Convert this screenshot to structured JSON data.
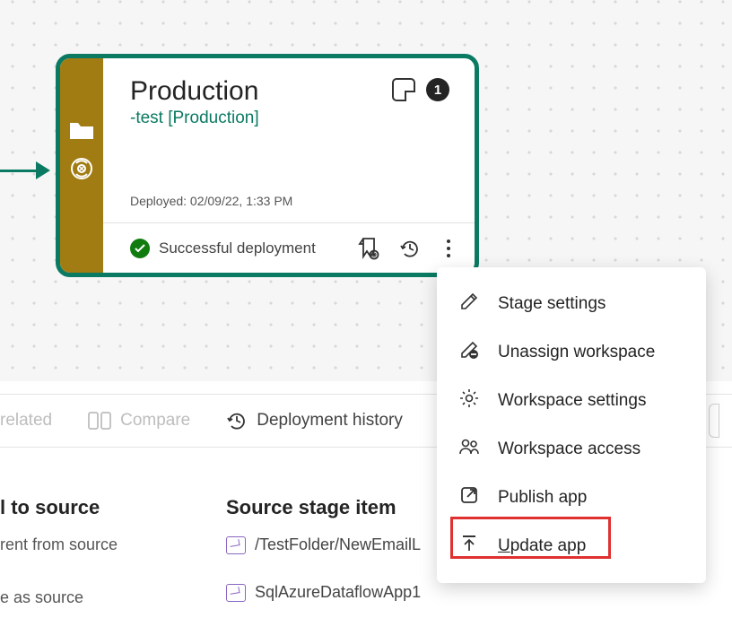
{
  "card": {
    "title": "Production",
    "subtitle": "-test [Production]",
    "deployed_label": "Deployed: 02/09/22, 1:33 PM",
    "badge_count": "1",
    "footer_status": "Successful deployment"
  },
  "context_menu": {
    "items": [
      {
        "label": "Stage settings",
        "icon": "pencil-icon"
      },
      {
        "label": "Unassign workspace",
        "icon": "unassign-icon"
      },
      {
        "label": "Workspace settings",
        "icon": "gear-icon"
      },
      {
        "label": "Workspace access",
        "icon": "people-icon"
      },
      {
        "label": "Publish app",
        "icon": "external-icon"
      },
      {
        "label": "Update app",
        "icon": "upload-icon"
      }
    ]
  },
  "toolbar": {
    "related": "related",
    "compare": "Compare",
    "history": "Deployment history"
  },
  "columns": {
    "col1_header": "l to source",
    "col1_row1": "rent from source",
    "col1_row2": "e as source",
    "col2_header": "Source stage item",
    "col2_row1": "/TestFolder/NewEmailL",
    "col2_row2": "SqlAzureDataflowApp1"
  }
}
